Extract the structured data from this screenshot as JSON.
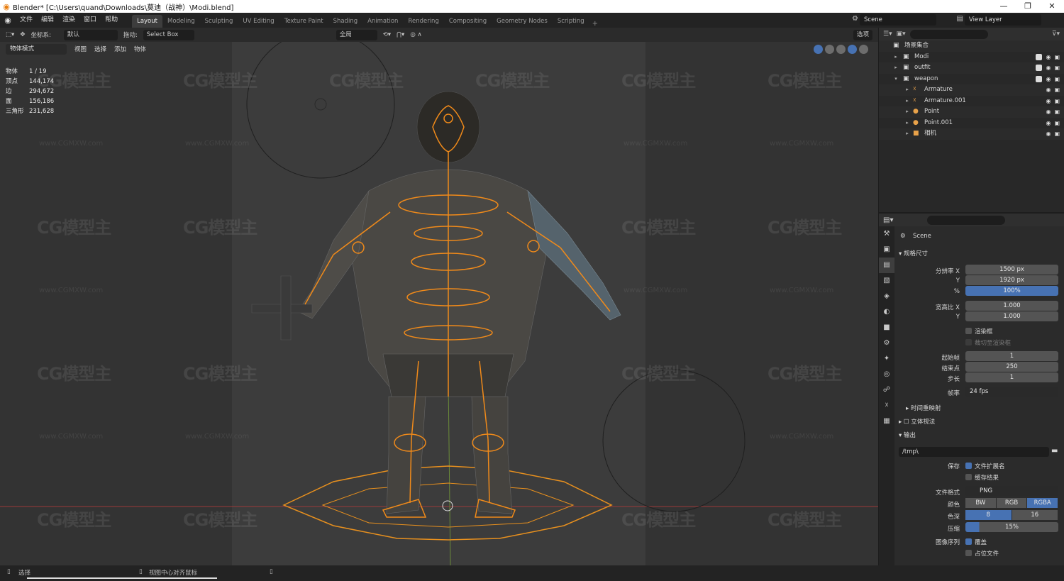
{
  "title_bar": {
    "title": "Blender* [C:\\Users\\quand\\Downloads\\莫迪（战神）\\Modi.blend]",
    "controls": [
      "—",
      "❐",
      "✕"
    ]
  },
  "menu": [
    "文件",
    "编辑",
    "渲染",
    "窗口",
    "帮助"
  ],
  "workspaces": {
    "tabs": [
      "Layout",
      "Modeling",
      "Sculpting",
      "UV Editing",
      "Texture Paint",
      "Shading",
      "Animation",
      "Rendering",
      "Compositing",
      "Geometry Nodes",
      "Scripting"
    ],
    "active": "Layout",
    "add": "+"
  },
  "scene_selector": "Scene",
  "view_layer": "View Layer",
  "viewport_header": {
    "coord_label": "坐标系:",
    "coord_value": "默认",
    "drag_label": "拖动:",
    "drag_value": "Select Box",
    "pivot_value": "全局",
    "options_value": "选项"
  },
  "viewport_menu": {
    "mode": "物体模式",
    "items": [
      "视图",
      "选择",
      "添加",
      "物体"
    ]
  },
  "stats": [
    {
      "key": "物体",
      "value": "1 / 19"
    },
    {
      "key": "顶点",
      "value": "144,174"
    },
    {
      "key": "边",
      "value": "294,672"
    },
    {
      "key": "面",
      "value": "156,186"
    },
    {
      "key": "三角形",
      "value": "231,628"
    }
  ],
  "watermark": {
    "logo_text": "CG模型主",
    "url": "www.CGMXW.com"
  },
  "outliner": {
    "root": "场景集合",
    "rows": [
      {
        "label": "Modi",
        "icon_color": "#bbbbbb"
      },
      {
        "label": "outfit",
        "icon_color": "#bbbbbb"
      },
      {
        "label": "weapon",
        "icon_color": "#bbbbbb"
      },
      {
        "label": "Armature",
        "icon_color": "#e8a24a"
      },
      {
        "label": "Armature.001",
        "icon_color": "#e8a24a"
      },
      {
        "label": "Point",
        "icon_color": "#e8a24a"
      },
      {
        "label": "Point.001",
        "icon_color": "#e8a24a"
      },
      {
        "label": "相机",
        "icon_color": "#e8a24a"
      }
    ]
  },
  "properties": {
    "context": "Scene",
    "format_section": "规格尺寸",
    "resolution_x_label": "分辨率 X",
    "resolution_x": "1500 px",
    "resolution_y_label": "Y",
    "resolution_y": "1920 px",
    "percent_label": "%",
    "percent": "100%",
    "aspect_x_label": "宽高比 X",
    "aspect_x": "1.000",
    "aspect_y_label": "Y",
    "aspect_y": "1.000",
    "render_region": "渲染框",
    "crop_region": "裁切至渲染框",
    "frame_start_label": "起始帧",
    "frame_start": "1",
    "frame_end_label": "结束点",
    "frame_end": "250",
    "frame_step_label": "步长",
    "frame_step": "1",
    "fps_label": "帧率",
    "fps": "24 fps",
    "time_remap": "时间重映射",
    "stereo": "立体视法",
    "output_section": "输出",
    "output_path": "/tmp\\",
    "save_label": "保存",
    "file_ext": "文件扩展名",
    "cache_result": "缓存结果",
    "file_format_label": "文件格式",
    "file_format": "PNG",
    "color_label": "颜色",
    "color_modes": [
      "BW",
      "RGB",
      "RGBA"
    ],
    "color_mode_active": "RGBA",
    "depth_label": "色深",
    "depth_options": [
      "8",
      "16"
    ],
    "compress_label": "压缩",
    "compress": "15%",
    "seq_label": "图像序列",
    "overwrite": "覆盖",
    "placeholders": "占位文件"
  },
  "statusbar": {
    "select": "选择",
    "center_view": "视图中心对齐鼠标"
  },
  "colors": {
    "accent": "#4772b3",
    "armature": "#e8a24a",
    "background": "#393939"
  }
}
